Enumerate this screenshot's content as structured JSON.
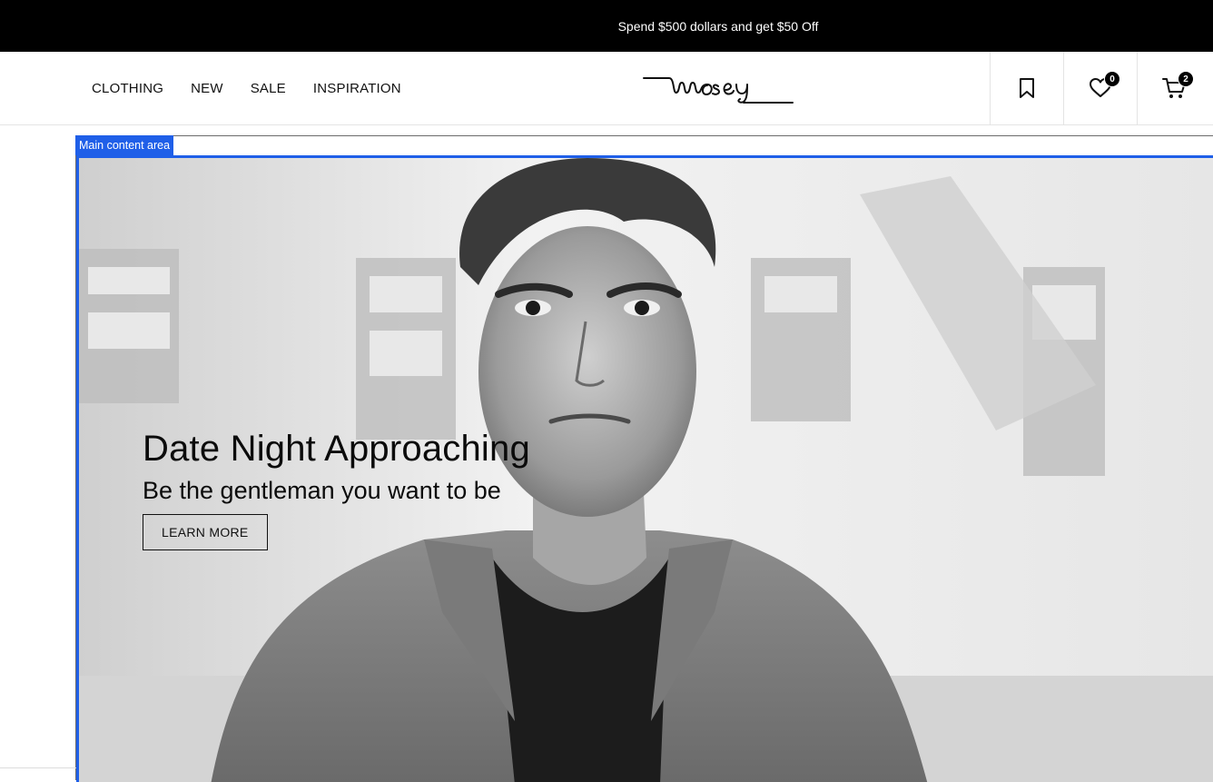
{
  "promo": {
    "text": "Spend $500 dollars and get $50 Off"
  },
  "nav": {
    "items": [
      "CLOTHING",
      "NEW",
      "SALE",
      "INSPIRATION"
    ]
  },
  "logo": {
    "text": "mosey"
  },
  "actions": {
    "bookmark_icon": "bookmark-icon",
    "wishlist_icon": "heart-icon",
    "wishlist_count": "0",
    "cart_icon": "cart-icon",
    "cart_count": "2"
  },
  "landmark": {
    "label": "Main content area"
  },
  "hero": {
    "title": "Date Night Approaching",
    "subtitle": "Be the gentleman you want to be",
    "cta_label": "LEARN MORE",
    "image": "black-and-white portrait of man in blazer"
  },
  "colors": {
    "accent": "#1f5fe8",
    "promo_bg": "#000000"
  }
}
